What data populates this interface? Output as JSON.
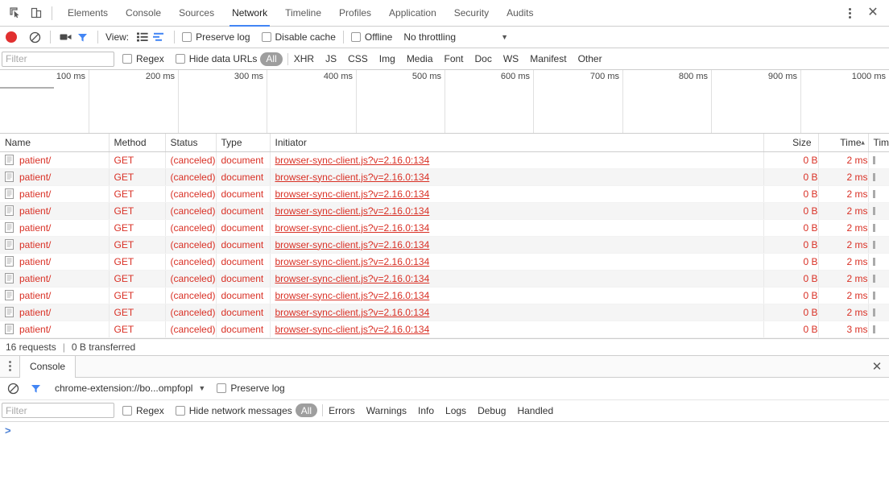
{
  "window": {
    "inspect_icon": "inspect-element-icon",
    "device_icon": "device-toolbar-icon",
    "more_icon": "more-options-icon",
    "close_icon": "close-icon"
  },
  "tabs": [
    {
      "label": "Elements",
      "active": false
    },
    {
      "label": "Console",
      "active": false
    },
    {
      "label": "Sources",
      "active": false
    },
    {
      "label": "Network",
      "active": true
    },
    {
      "label": "Timeline",
      "active": false
    },
    {
      "label": "Profiles",
      "active": false
    },
    {
      "label": "Application",
      "active": false
    },
    {
      "label": "Security",
      "active": false
    },
    {
      "label": "Audits",
      "active": false
    }
  ],
  "network_toolbar": {
    "record_title": "record-button",
    "clear_title": "clear-button",
    "capture_screenshots_title": "camera-icon",
    "filter_title": "filter-icon",
    "view_label": "View:",
    "list_view_title": "list-view-icon",
    "waterfall_view_title": "waterfall-view-icon",
    "preserve_log": "Preserve log",
    "disable_cache": "Disable cache",
    "offline": "Offline",
    "throttling": "No throttling",
    "caret": "▼"
  },
  "network_filter": {
    "placeholder": "Filter",
    "value": "",
    "regex": "Regex",
    "hide_data_urls": "Hide data URLs",
    "types": [
      "All",
      "XHR",
      "JS",
      "CSS",
      "Img",
      "Media",
      "Font",
      "Doc",
      "WS",
      "Manifest",
      "Other"
    ],
    "active_type": "All"
  },
  "overview": {
    "ticks": [
      "100 ms",
      "200 ms",
      "300 ms",
      "400 ms",
      "500 ms",
      "600 ms",
      "700 ms",
      "800 ms",
      "900 ms",
      "1000 ms"
    ]
  },
  "table": {
    "columns": [
      "Name",
      "Method",
      "Status",
      "Type",
      "Initiator",
      "Size",
      "Time",
      "Timeline"
    ],
    "sort_column": "Time",
    "sort_arrow": "▲",
    "rows": [
      {
        "name": "patient/",
        "method": "GET",
        "status": "(canceled)",
        "type": "document",
        "initiator": "browser-sync-client.js?v=2.16.0:134",
        "size": "0 B",
        "time": "2 ms"
      },
      {
        "name": "patient/",
        "method": "GET",
        "status": "(canceled)",
        "type": "document",
        "initiator": "browser-sync-client.js?v=2.16.0:134",
        "size": "0 B",
        "time": "2 ms"
      },
      {
        "name": "patient/",
        "method": "GET",
        "status": "(canceled)",
        "type": "document",
        "initiator": "browser-sync-client.js?v=2.16.0:134",
        "size": "0 B",
        "time": "2 ms"
      },
      {
        "name": "patient/",
        "method": "GET",
        "status": "(canceled)",
        "type": "document",
        "initiator": "browser-sync-client.js?v=2.16.0:134",
        "size": "0 B",
        "time": "2 ms"
      },
      {
        "name": "patient/",
        "method": "GET",
        "status": "(canceled)",
        "type": "document",
        "initiator": "browser-sync-client.js?v=2.16.0:134",
        "size": "0 B",
        "time": "2 ms"
      },
      {
        "name": "patient/",
        "method": "GET",
        "status": "(canceled)",
        "type": "document",
        "initiator": "browser-sync-client.js?v=2.16.0:134",
        "size": "0 B",
        "time": "2 ms"
      },
      {
        "name": "patient/",
        "method": "GET",
        "status": "(canceled)",
        "type": "document",
        "initiator": "browser-sync-client.js?v=2.16.0:134",
        "size": "0 B",
        "time": "2 ms"
      },
      {
        "name": "patient/",
        "method": "GET",
        "status": "(canceled)",
        "type": "document",
        "initiator": "browser-sync-client.js?v=2.16.0:134",
        "size": "0 B",
        "time": "2 ms"
      },
      {
        "name": "patient/",
        "method": "GET",
        "status": "(canceled)",
        "type": "document",
        "initiator": "browser-sync-client.js?v=2.16.0:134",
        "size": "0 B",
        "time": "2 ms"
      },
      {
        "name": "patient/",
        "method": "GET",
        "status": "(canceled)",
        "type": "document",
        "initiator": "browser-sync-client.js?v=2.16.0:134",
        "size": "0 B",
        "time": "2 ms"
      },
      {
        "name": "patient/",
        "method": "GET",
        "status": "(canceled)",
        "type": "document",
        "initiator": "browser-sync-client.js?v=2.16.0:134",
        "size": "0 B",
        "time": "3 ms"
      }
    ]
  },
  "status_bar": {
    "requests": "16 requests",
    "separator": "|",
    "transferred": "0 B transferred"
  },
  "drawer": {
    "tab_label": "Console",
    "close_icon": "close-icon",
    "clear_icon": "clear-console-icon",
    "filter_icon": "filter-icon",
    "context": "chrome-extension://bo...ompfopl",
    "context_caret": "▼",
    "preserve_log": "Preserve log",
    "filter_placeholder": "Filter",
    "filter_value": "",
    "regex": "Regex",
    "hide_network_messages": "Hide network messages",
    "levels": [
      "All",
      "Errors",
      "Warnings",
      "Info",
      "Logs",
      "Debug",
      "Handled"
    ],
    "active_level": "All",
    "prompt": ">"
  },
  "colors": {
    "accent": "#4285f4",
    "error_red": "#d93025",
    "record_red": "#e13030",
    "pill_gray": "#9e9e9e"
  }
}
